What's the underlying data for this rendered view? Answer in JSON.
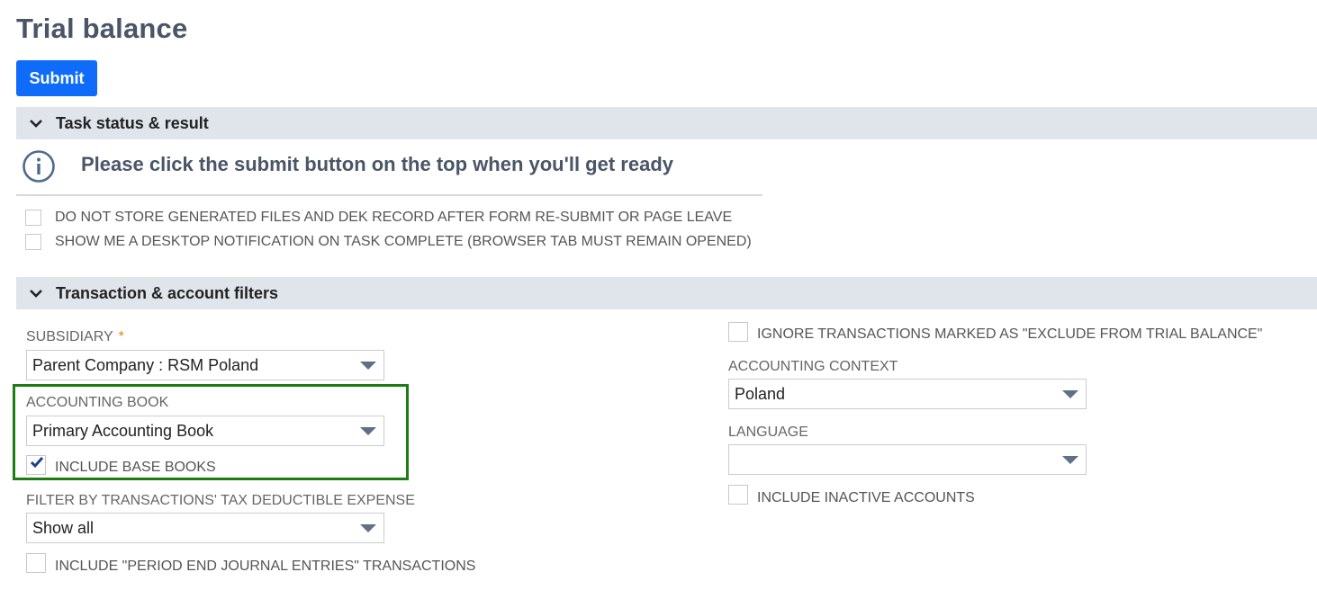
{
  "page": {
    "title": "Trial balance",
    "submit_label": "Submit"
  },
  "task_section": {
    "label": "Task status & result",
    "info_message": "Please click the submit button on the top when you'll get ready",
    "checkboxes": [
      {
        "label": "DO NOT STORE GENERATED FILES AND DEK RECORD AFTER FORM RE-SUBMIT OR PAGE LEAVE",
        "checked": false
      },
      {
        "label": "SHOW ME A DESKTOP NOTIFICATION ON TASK COMPLETE (BROWSER TAB MUST REMAIN OPENED)",
        "checked": false
      }
    ]
  },
  "filters_section": {
    "label": "Transaction & account filters",
    "subsidiary": {
      "label": "SUBSIDIARY",
      "required_mark": "*",
      "value": "Parent Company : RSM Poland"
    },
    "accounting_book": {
      "label": "ACCOUNTING BOOK",
      "value": "Primary Accounting Book"
    },
    "include_base_books": {
      "label": "INCLUDE BASE BOOKS",
      "checked": true
    },
    "tax_deductible": {
      "label": "FILTER BY TRANSACTIONS' TAX DEDUCTIBLE EXPENSE",
      "value": "Show all"
    },
    "period_end": {
      "label": "INCLUDE \"PERIOD END JOURNAL ENTRIES\" TRANSACTIONS",
      "checked": false
    },
    "ignore_excluded": {
      "label": "IGNORE TRANSACTIONS MARKED AS \"EXCLUDE FROM TRIAL BALANCE\"",
      "checked": false
    },
    "accounting_context": {
      "label": "ACCOUNTING CONTEXT",
      "value": "Poland"
    },
    "language": {
      "label": "LANGUAGE",
      "value": ""
    },
    "include_inactive": {
      "label": "INCLUDE INACTIVE ACCOUNTS",
      "checked": false
    }
  },
  "colors": {
    "accent": "#0f6cfb",
    "highlight_border": "#1c7d14",
    "section_bar": "#e0e5ec",
    "required": "#e08a00"
  }
}
